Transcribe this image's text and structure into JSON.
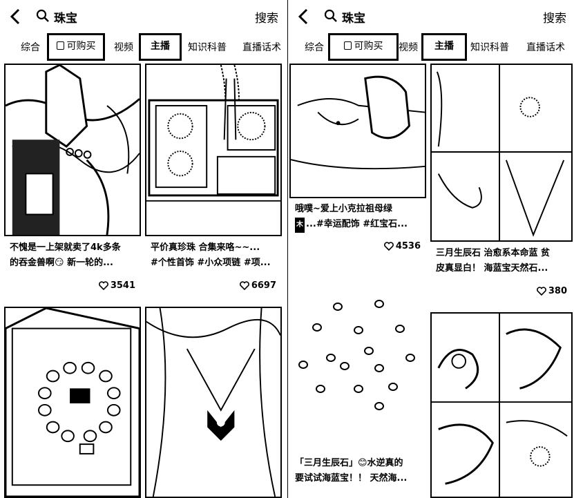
{
  "left": {
    "search": {
      "query": "珠宝",
      "button": "搜索"
    },
    "tabs": [
      "综合",
      "可购买",
      "视频",
      "主播",
      "知识科普",
      "直播话术"
    ],
    "cards": [
      {
        "title_line1": "不愧是一上架就卖了4k多条",
        "title_line2": "的吞金兽啊😏 新一轮的...",
        "likes": "3541"
      },
      {
        "title_line1": "平价真珍珠 合集来咯~~...",
        "title_line2": "#个性首饰 #小众项链 #项...",
        "likes": "6697"
      },
      {
        "title_line1": "",
        "title_line2": "",
        "likes": ""
      },
      {
        "title_line1": "",
        "title_line2": "",
        "likes": ""
      }
    ]
  },
  "right": {
    "search": {
      "query": "珠宝",
      "button": "搜索"
    },
    "tabs": [
      "综合",
      "可购买",
      "视频",
      "主播",
      "知识科普",
      "直播话术"
    ],
    "cards": [
      {
        "title_line1": "哦噗~爱上小克拉祖母绿",
        "badge": "木",
        "title_line2": "...#幸运配饰 #红宝石...",
        "likes": "4536"
      },
      {
        "title_line1": "三月生辰石 治愈系本命蓝 贫",
        "title_line2": "皮真显白！ 海蓝宝天然石...",
        "likes": "380"
      },
      {
        "title_line1": "「三月生辰石」😊水逆真的",
        "title_line2": "要试试海蓝宝！！ 天然海...",
        "likes": ""
      },
      {
        "title_line1": "",
        "title_line2": "",
        "likes": ""
      }
    ]
  },
  "icons": {
    "back": "chevron-left-icon",
    "search": "search-icon",
    "shop": "shopping-bag-icon",
    "like": "heart-icon"
  }
}
